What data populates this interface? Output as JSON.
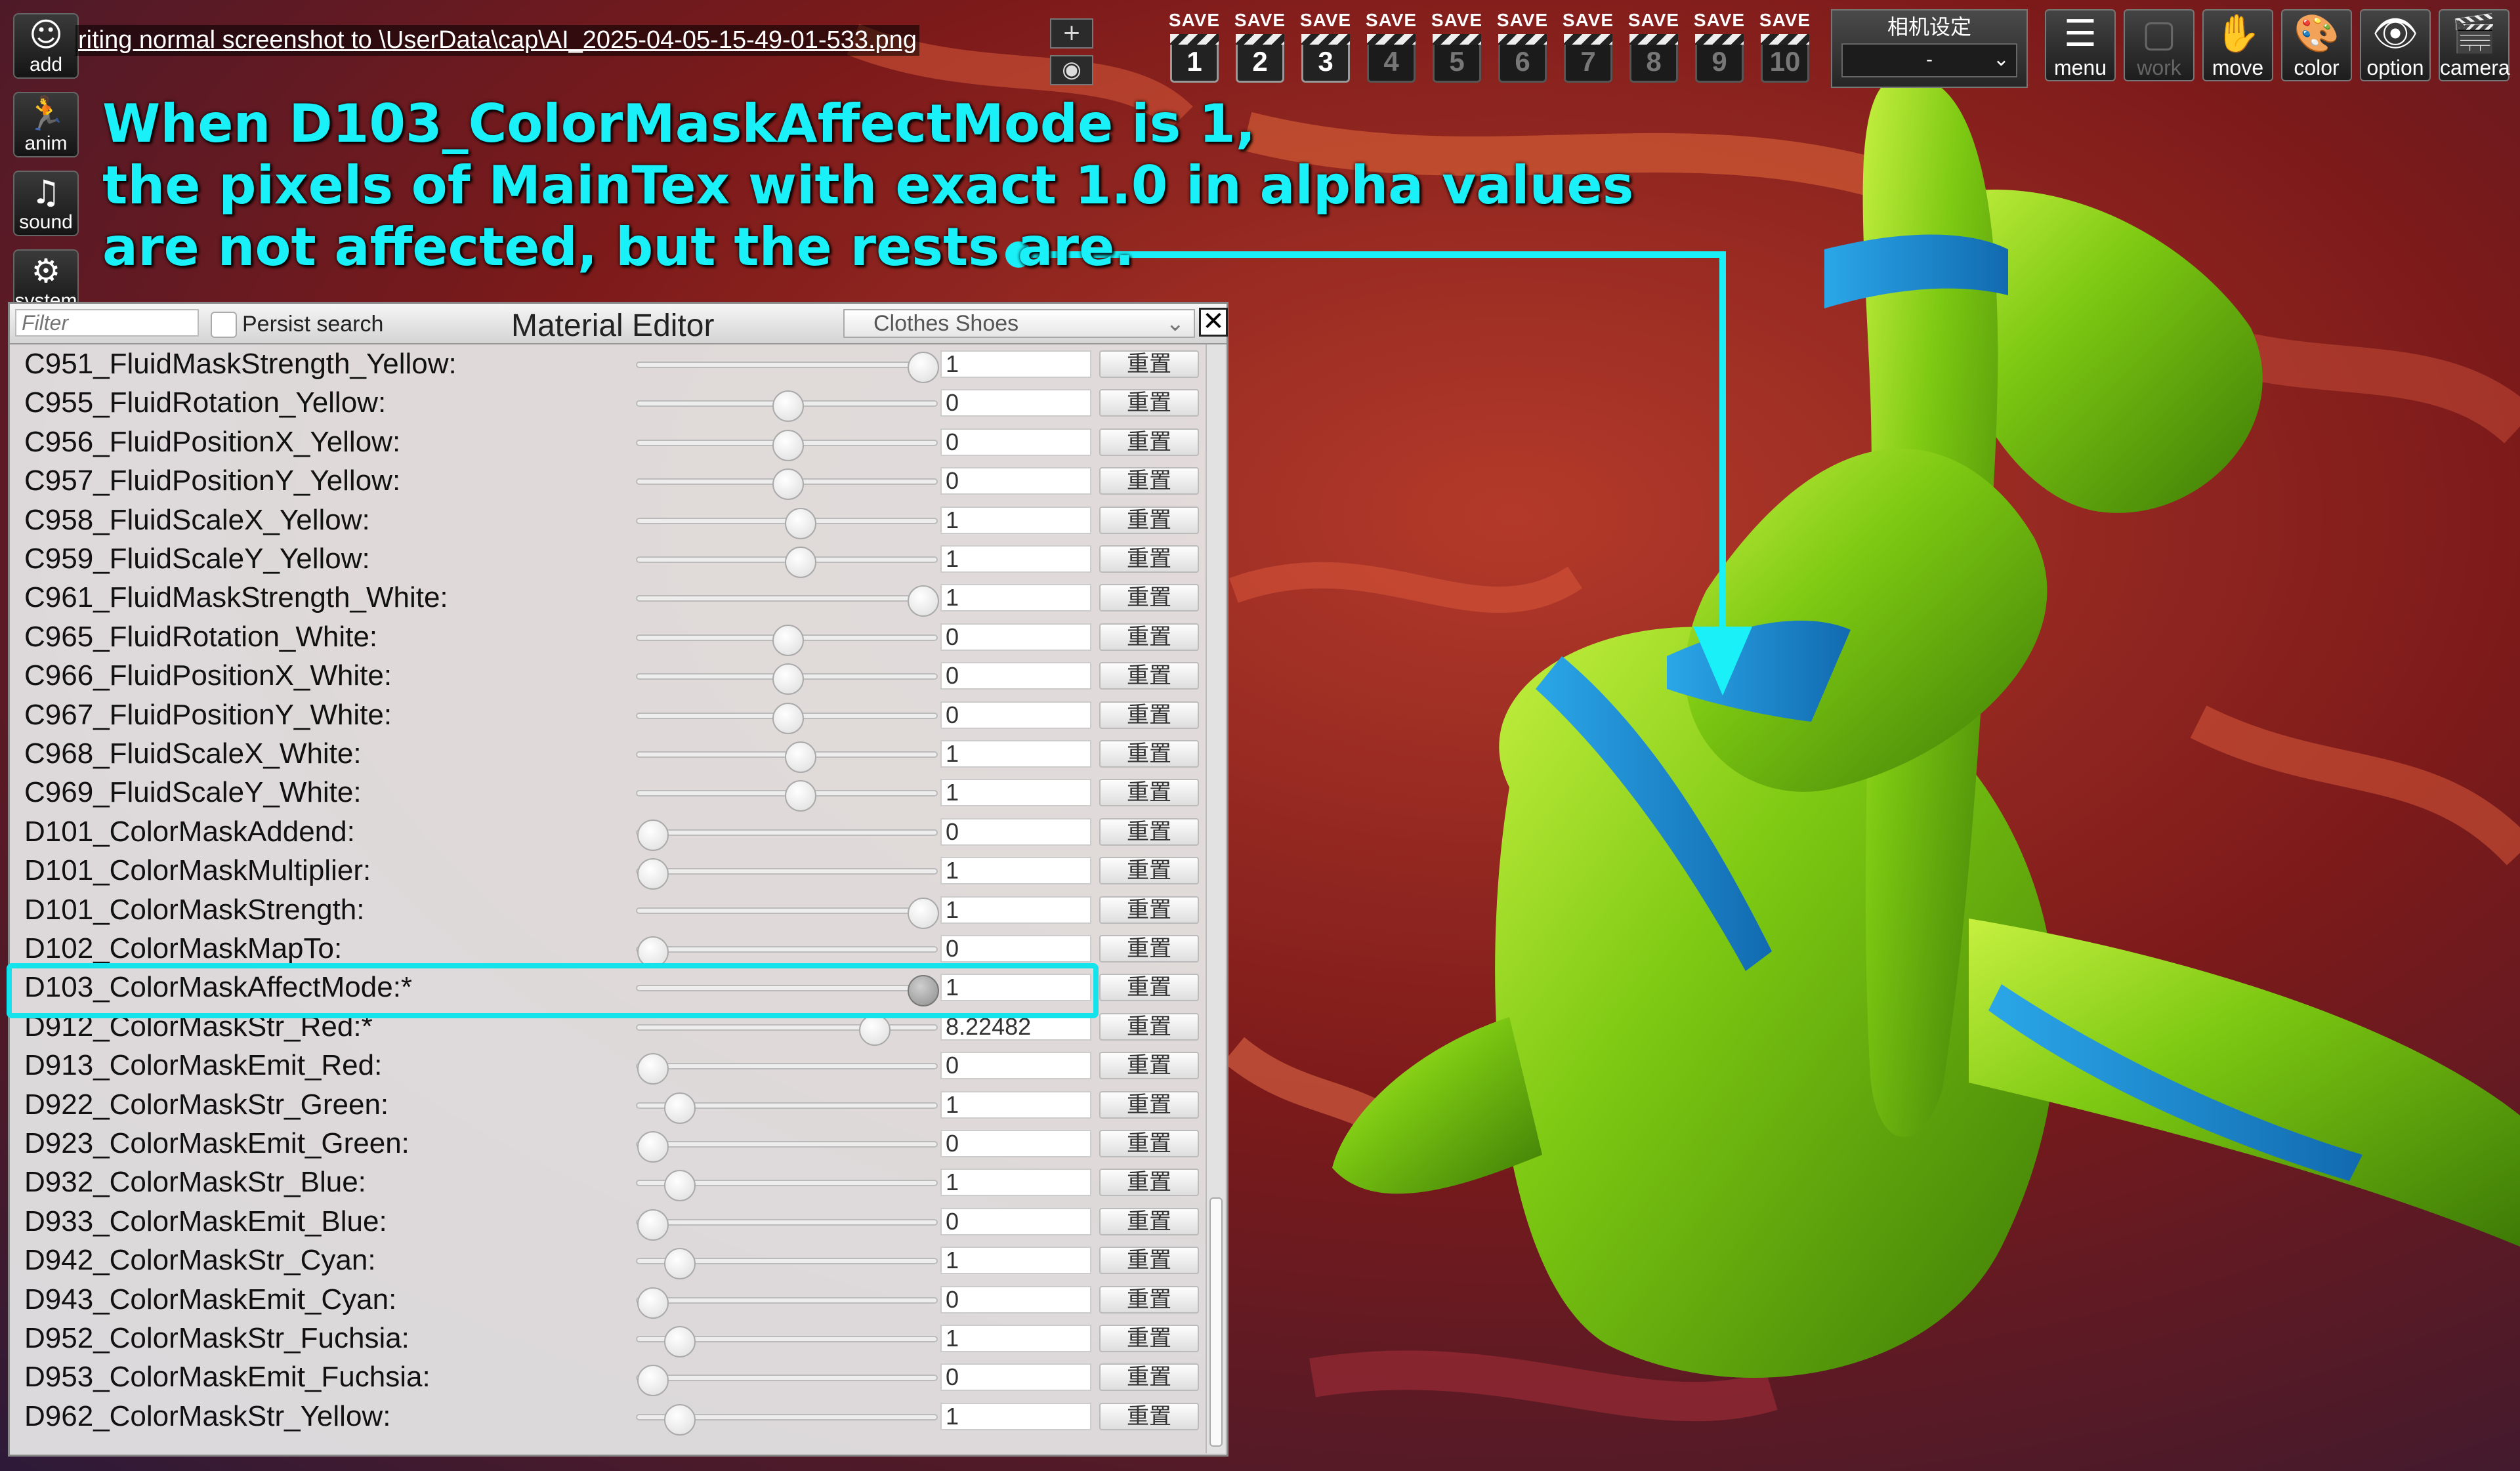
{
  "left_toolbar": [
    {
      "label": "add",
      "icon": "add-person-icon",
      "glyph": "☺"
    },
    {
      "label": "anim",
      "icon": "running-figure-icon",
      "glyph": "🏃"
    },
    {
      "label": "sound",
      "icon": "music-note-icon",
      "glyph": "♫"
    },
    {
      "label": "system",
      "icon": "gears-icon",
      "glyph": "⚙"
    }
  ],
  "status_text": "riting normal screenshot to \\UserData\\cap\\AI_2025-04-05-15-49-01-533.png",
  "small_buttons": {
    "plus": "+",
    "eye": "◉"
  },
  "save_label": "SAVE",
  "save_slots": [
    "1",
    "2",
    "3",
    "4",
    "5",
    "6",
    "7",
    "8",
    "9",
    "10"
  ],
  "camera_settings": {
    "title": "相机设定",
    "value": "-"
  },
  "right_toolbar": [
    {
      "label": "menu",
      "icon": "menu-list-icon",
      "glyph": "☰"
    },
    {
      "label": "work",
      "icon": "work-frame-icon",
      "glyph": "▢"
    },
    {
      "label": "move",
      "icon": "hand-icon",
      "glyph": "✋"
    },
    {
      "label": "color",
      "icon": "palette-icon",
      "glyph": "🎨"
    },
    {
      "label": "option",
      "icon": "eye-icon",
      "glyph": "👁"
    },
    {
      "label": "camera",
      "icon": "clapperboard-icon",
      "glyph": "🎬"
    }
  ],
  "annotation": {
    "line1": "When D103_ColorMaskAffectMode is 1,",
    "line2": "the pixels of MainTex with exact 1.0 in alpha values",
    "line3": "are not affected, but the rests are.",
    "accent": "#19f0f7"
  },
  "editor": {
    "filter_placeholder": "Filter",
    "persist_label": "Persist search",
    "title": "Material Editor",
    "category": "Clothes Shoes",
    "close": "✕",
    "reset_label": "重置",
    "highlighted_property": "D103_ColorMaskAffectMode:*",
    "highlight_color": "#14e3ec",
    "properties": [
      {
        "label": "C951_FluidMaskStrength_Yellow:",
        "value": "1",
        "slider": 1.0
      },
      {
        "label": "C955_FluidRotation_Yellow:",
        "value": "0",
        "slider": 0.5
      },
      {
        "label": "C956_FluidPositionX_Yellow:",
        "value": "0",
        "slider": 0.5
      },
      {
        "label": "C957_FluidPositionY_Yellow:",
        "value": "0",
        "slider": 0.5
      },
      {
        "label": "C958_FluidScaleX_Yellow:",
        "value": "1",
        "slider": 0.545
      },
      {
        "label": "C959_FluidScaleY_Yellow:",
        "value": "1",
        "slider": 0.545
      },
      {
        "label": "C961_FluidMaskStrength_White:",
        "value": "1",
        "slider": 1.0
      },
      {
        "label": "C965_FluidRotation_White:",
        "value": "0",
        "slider": 0.5
      },
      {
        "label": "C966_FluidPositionX_White:",
        "value": "0",
        "slider": 0.5
      },
      {
        "label": "C967_FluidPositionY_White:",
        "value": "0",
        "slider": 0.5
      },
      {
        "label": "C968_FluidScaleX_White:",
        "value": "1",
        "slider": 0.545
      },
      {
        "label": "C969_FluidScaleY_White:",
        "value": "1",
        "slider": 0.545
      },
      {
        "label": "D101_ColorMaskAddend:",
        "value": "0",
        "slider": 0.0
      },
      {
        "label": "D101_ColorMaskMultiplier:",
        "value": "1",
        "slider": 0.0
      },
      {
        "label": "D101_ColorMaskStrength:",
        "value": "1",
        "slider": 1.0
      },
      {
        "label": "D102_ColorMaskMapTo:",
        "value": "0",
        "slider": 0.0
      },
      {
        "label": "D103_ColorMaskAffectMode:*",
        "value": "1",
        "slider": 1.0
      },
      {
        "label": "D912_ColorMaskStr_Red:*",
        "value": "8.22482",
        "slider": 0.82
      },
      {
        "label": "D913_ColorMaskEmit_Red:",
        "value": "0",
        "slider": 0.0
      },
      {
        "label": "D922_ColorMaskStr_Green:",
        "value": "1",
        "slider": 0.1
      },
      {
        "label": "D923_ColorMaskEmit_Green:",
        "value": "0",
        "slider": 0.0
      },
      {
        "label": "D932_ColorMaskStr_Blue:",
        "value": "1",
        "slider": 0.1
      },
      {
        "label": "D933_ColorMaskEmit_Blue:",
        "value": "0",
        "slider": 0.0
      },
      {
        "label": "D942_ColorMaskStr_Cyan:",
        "value": "1",
        "slider": 0.1
      },
      {
        "label": "D943_ColorMaskEmit_Cyan:",
        "value": "0",
        "slider": 0.0
      },
      {
        "label": "D952_ColorMaskStr_Fuchsia:",
        "value": "1",
        "slider": 0.1
      },
      {
        "label": "D953_ColorMaskEmit_Fuchsia:",
        "value": "0",
        "slider": 0.0
      },
      {
        "label": "D962_ColorMaskStr_Yellow:",
        "value": "1",
        "slider": 0.1
      }
    ]
  },
  "colors": {
    "figure_green": "#7ac70f",
    "figure_blue": "#1d8fd4",
    "background_red": "#8a1f1b"
  }
}
